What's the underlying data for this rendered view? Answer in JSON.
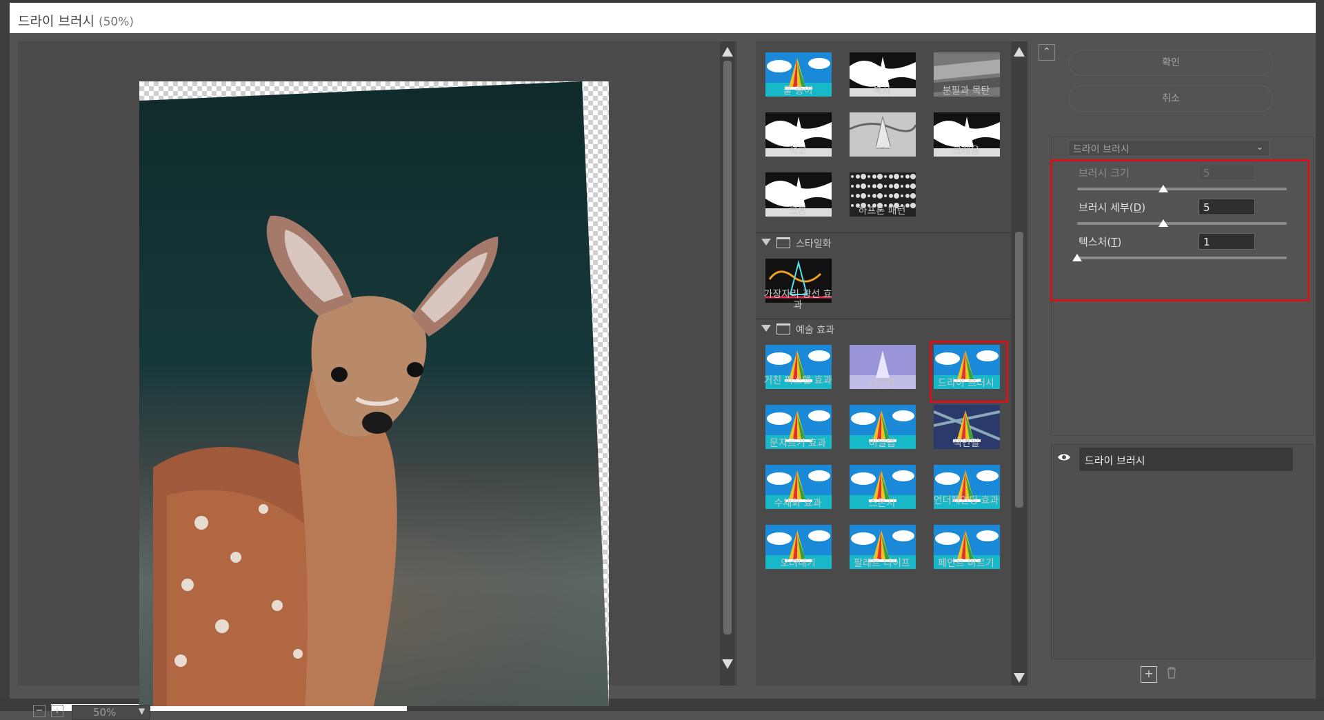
{
  "dialog": {
    "title": "드라이 브러시",
    "zoom_suffix": "(50%)"
  },
  "preview": {
    "zoom_value": "50%",
    "zoom_minus": "−",
    "zoom_plus": "+"
  },
  "gallery": {
    "groups": [
      {
        "category": null,
        "items": [
          "물 종이",
          "복사",
          "분필과 목탄",
          "석고",
          "저부조",
          "크레용",
          "크롬",
          "하프톤 패턴"
        ]
      },
      {
        "category": "스타일화",
        "items": [
          "가장자리 광선 효과"
        ]
      },
      {
        "category": "예술 효과",
        "items": [
          "거친 파스텔 효과",
          "네온광",
          "드라이 브러시",
          "문지르기 효과",
          "비닐랩",
          "색연필",
          "수채화 효과",
          "스폰지",
          "언더페인팅 효과",
          "오려내기",
          "팔레트 나이프",
          "페인트 바르기"
        ]
      }
    ],
    "selected_item": "드라이 브러시"
  },
  "settings": {
    "ok_label": "확인",
    "cancel_label": "취소",
    "filter_dropdown": "드라이 브러시",
    "params": [
      {
        "label": "브러시 크기",
        "value": "5",
        "enabled": false,
        "slider_fraction": 0.41
      },
      {
        "label": "브러시 세부",
        "mnemonic": "D",
        "value": "5",
        "enabled": true,
        "slider_fraction": 0.41
      },
      {
        "label": "텍스처",
        "mnemonic": "T",
        "value": "1",
        "enabled": true,
        "slider_fraction": 0.0
      }
    ],
    "layer_name": "드라이 브러시"
  },
  "colors": {
    "highlight": "#d4121a",
    "background": "#535353"
  }
}
